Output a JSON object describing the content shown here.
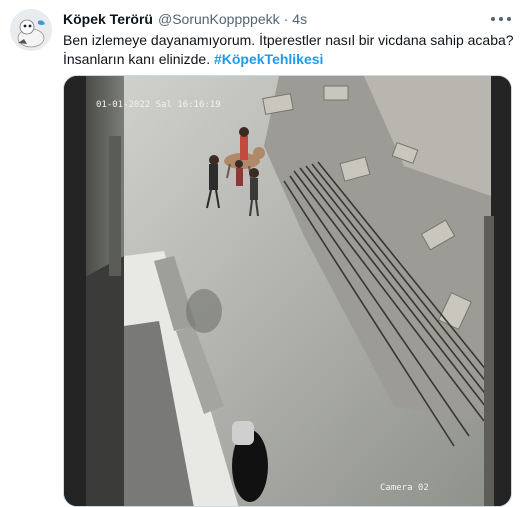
{
  "tweet": {
    "author_name": "Köpek Terörü",
    "author_handle": "@SorunKoppppekk",
    "separator": "·",
    "time": "4s",
    "text_line1": "Ben izlemeye dayanamıyorum. İtperestler nasıl bir vicdana sahip acaba?",
    "text_line2": "İnsanların kanı elinizde.",
    "hashtag": "#KöpekTehlikesi"
  },
  "media": {
    "timestamp_overlay": "01-01-2022 Sal 16:16:19",
    "camera_label": "Camera 02"
  },
  "icons": {
    "more": "more-options-icon",
    "avatar": "avatar-image"
  },
  "colors": {
    "link": "#1d9bf0",
    "text": "#0f1419",
    "muted": "#536471"
  }
}
